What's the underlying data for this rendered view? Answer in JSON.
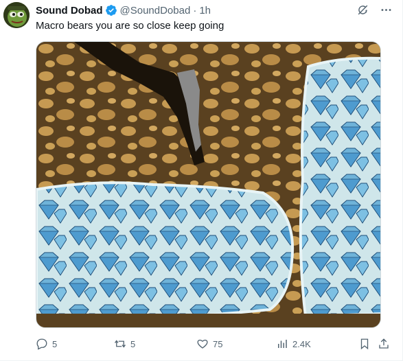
{
  "tweet": {
    "display_name": "Sound Dobad",
    "handle": "@SoundDobad",
    "separator": "·",
    "time": "1h",
    "text": "Macro bears you are so close keep going",
    "replies": "5",
    "reposts": "5",
    "likes": "75",
    "views": "2.4K"
  },
  "icons": {
    "verified": "verified-badge-icon",
    "grok": "grok-icon",
    "more": "more-icon",
    "reply": "reply-icon",
    "repost": "repost-icon",
    "like": "heart-icon",
    "views": "views-icon",
    "bookmark": "bookmark-icon",
    "share": "share-icon"
  },
  "colors": {
    "verified": "#1d9bf0",
    "secondary_text": "#536471",
    "primary_text": "#0f1419"
  }
}
